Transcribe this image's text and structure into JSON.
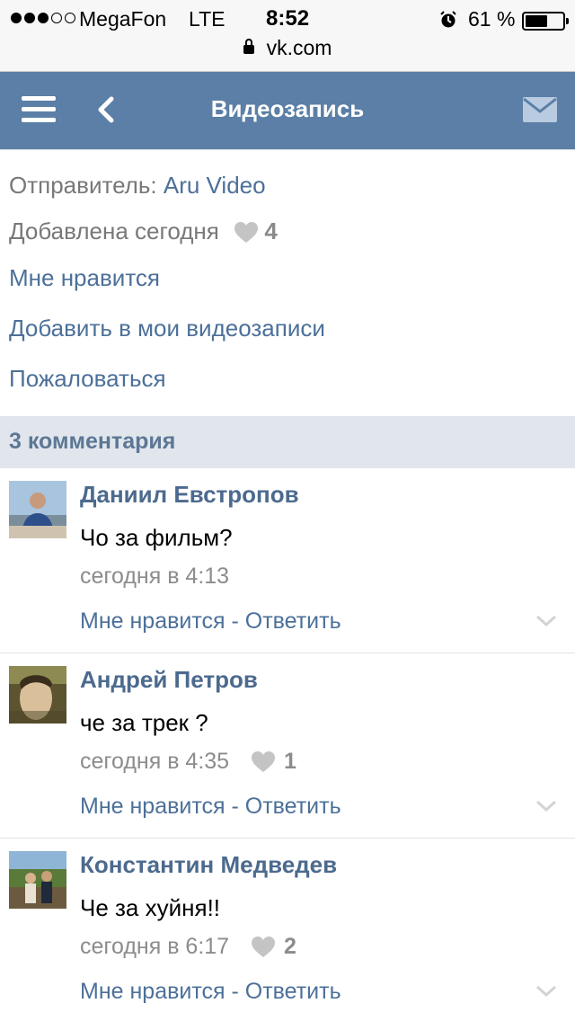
{
  "status_bar": {
    "carrier": "MegaFon",
    "network": "LTE",
    "time": "8:52",
    "battery_percent": "61 %",
    "battery_level": 0.61,
    "signal_bars_filled": 3,
    "signal_bars_total": 5,
    "url": "vk.com"
  },
  "nav": {
    "title": "Видеозапись",
    "menu_icon": "hamburger-icon",
    "back_icon": "chevron-left-icon",
    "mail_icon": "envelope-icon",
    "color": "#5b7fa6"
  },
  "info": {
    "sender_label": "Отправитель:",
    "sender_name": "Aru Video",
    "added": "Добавлена сегодня",
    "likes": "4",
    "like_action": "Мне нравится",
    "add_to_videos": "Добавить в мои видеозаписи",
    "report": "Пожаловаться"
  },
  "comments_header": "3 комментария",
  "comments": [
    {
      "author": "Даниил Евстропов",
      "text": "Чо за фильм?",
      "date": "сегодня в 4:13",
      "likes": "",
      "actions": "Мне нравится - Ответить"
    },
    {
      "author": "Андрей Петров",
      "text": "че за трек ?",
      "date": "сегодня в 4:35",
      "likes": "1",
      "actions": "Мне нравится - Ответить"
    },
    {
      "author": "Константин Медведев",
      "text": "Че за хуйня!!",
      "date": "сегодня в 6:17",
      "likes": "2",
      "actions": "Мне нравится - Ответить"
    }
  ]
}
